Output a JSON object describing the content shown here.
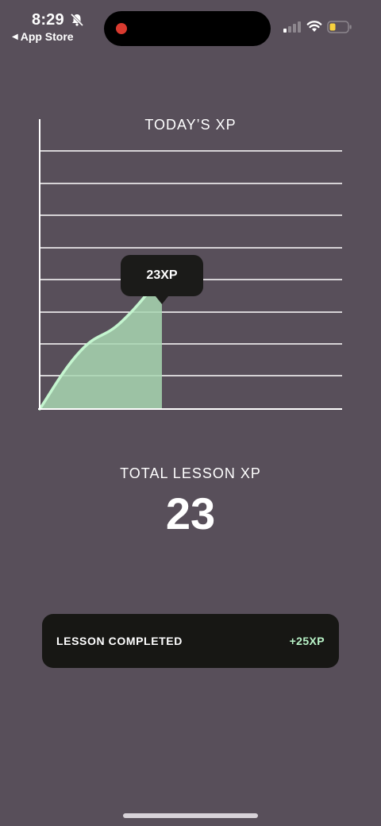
{
  "status_bar": {
    "time": "8:29",
    "back_app": "App Store",
    "back_caret": "◀",
    "icons": [
      "bell-slash-icon",
      "signal-icon",
      "wifi-icon",
      "battery-icon"
    ],
    "recording": true
  },
  "chart": {
    "title": "TODAY’S XP",
    "tooltip": "23XP"
  },
  "chart_data": {
    "type": "area",
    "title": "TODAY’S XP",
    "xlabel": "",
    "ylabel": "",
    "x": [
      0,
      1,
      2,
      3
    ],
    "values": [
      0,
      10,
      15,
      23
    ],
    "highlight_value": "23XP",
    "grid": true,
    "ylim": [
      0,
      50
    ],
    "colors": {
      "fill": "#a8d6b2",
      "line": "#c4f5cf",
      "grid": "#ffffff"
    }
  },
  "totals": {
    "label": "TOTAL LESSON XP",
    "value": "23"
  },
  "lesson": {
    "label": "LESSON COMPLETED",
    "xp": "+25XP"
  },
  "colors": {
    "background": "#584f5a",
    "card": "#171714",
    "accent_green": "#b9f4c8",
    "record_red": "#d93a2f"
  }
}
